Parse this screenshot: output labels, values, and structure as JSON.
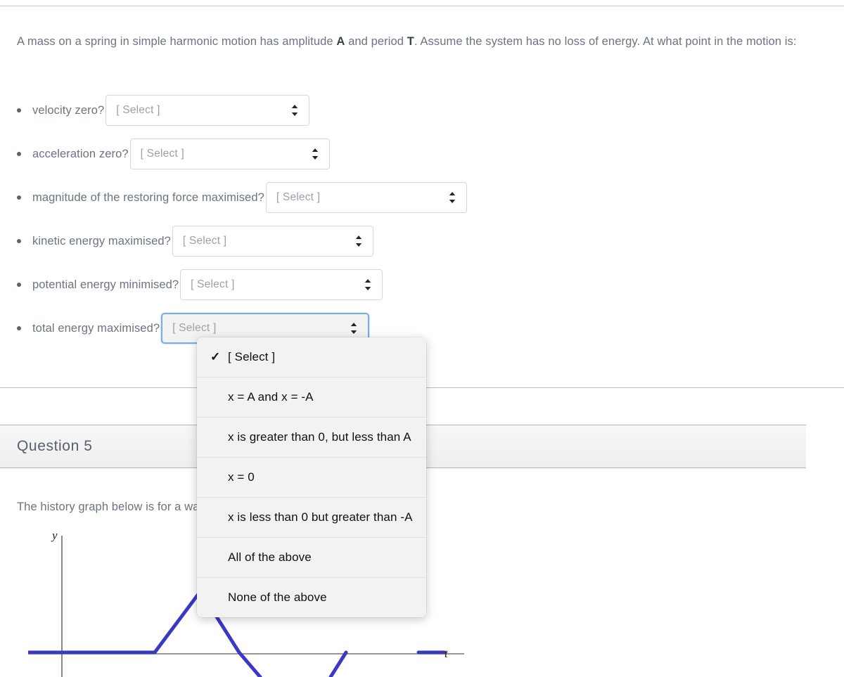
{
  "prompt": {
    "before_a": "A mass on a spring in simple harmonic motion has amplitude ",
    "var_a": "A",
    "between": " and period ",
    "var_t": "T",
    "after": ". Assume the system has no loss of energy. At what point in the motion is:"
  },
  "select_placeholder": "[ Select ]",
  "bullets": [
    {
      "label": "velocity zero?",
      "value": "[ Select ]"
    },
    {
      "label": "acceleration zero?",
      "value": "[ Select ]"
    },
    {
      "label": "magnitude of the restoring force maximised?",
      "value": "[ Select ]"
    },
    {
      "label": "kinetic energy maximised?",
      "value": "[ Select ]"
    },
    {
      "label": "potential energy minimised?",
      "value": "[ Select ]"
    },
    {
      "label": "total energy maximised?",
      "value": "[ Select ]"
    }
  ],
  "dropdown": {
    "open_for": "total energy maximised?",
    "checkmark": "✓",
    "options": [
      {
        "label": "[ Select ]",
        "selected": true
      },
      {
        "label": "x = A and x = -A",
        "selected": false
      },
      {
        "label": "x is greater than 0, but less than A",
        "selected": false
      },
      {
        "label": "x = 0",
        "selected": false
      },
      {
        "label": "x is less than 0 but greater than -A",
        "selected": false
      },
      {
        "label": "All of the above",
        "selected": false
      },
      {
        "label": "None of the above",
        "selected": false
      }
    ]
  },
  "question5": {
    "title": "Question 5",
    "body": "The history graph below is for a wave moving in the positive x-direction).",
    "graph": {
      "y_axis_label": "y",
      "t_axis_label": "t",
      "curve_color": "#3b38c4",
      "axis_color": "#555555"
    }
  },
  "colors": {
    "body_text": "#6b7480",
    "heading_text": "#55606b",
    "focus_border": "#7aaede",
    "select_border": "#d4d7da",
    "placeholder_text": "#9aa1a8",
    "menu_bg": "#f2f2f2",
    "band_bg": "#eeeeee"
  }
}
